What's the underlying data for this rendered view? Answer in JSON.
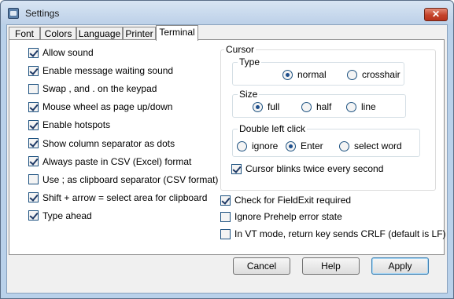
{
  "window": {
    "title": "Settings",
    "close_glyph": "✕"
  },
  "tabs": [
    "Font",
    "Colors",
    "Language",
    "Printer",
    "Terminal"
  ],
  "active_tab": "Terminal",
  "options": [
    {
      "label": "Allow sound",
      "checked": true
    },
    {
      "label": "Enable message waiting sound",
      "checked": true
    },
    {
      "label": "Swap , and . on the keypad",
      "checked": false
    },
    {
      "label": "Mouse wheel as page up/down",
      "checked": true
    },
    {
      "label": "Enable hotspots",
      "checked": true
    },
    {
      "label": "Show column separator as dots",
      "checked": true
    },
    {
      "label": "Always paste in CSV (Excel) format",
      "checked": true
    },
    {
      "label": "Use ; as clipboard separator (CSV format)",
      "checked": false
    },
    {
      "label": "Shift + arrow = select area for clipboard",
      "checked": true
    },
    {
      "label": "Type ahead",
      "checked": true
    }
  ],
  "cursor": {
    "label": "Cursor",
    "type": {
      "label": "Type",
      "options": [
        "normal",
        "crosshair"
      ],
      "selected": "normal"
    },
    "size": {
      "label": "Size",
      "options": [
        "full",
        "half",
        "line"
      ],
      "selected": "full"
    },
    "double_click": {
      "label": "Double left click",
      "options": [
        "ignore",
        "Enter",
        "select word"
      ],
      "selected": "Enter"
    },
    "blink": {
      "label": "Cursor blinks twice every second",
      "checked": true
    }
  },
  "extra_options": [
    {
      "label": "Check for FieldExit required",
      "checked": true
    },
    {
      "label": "Ignore Prehelp error state",
      "checked": false
    },
    {
      "label": "In VT mode, return key sends CRLF (default is LF)",
      "checked": false
    }
  ],
  "buttons": {
    "cancel": "Cancel",
    "help": "Help",
    "apply": "Apply"
  }
}
